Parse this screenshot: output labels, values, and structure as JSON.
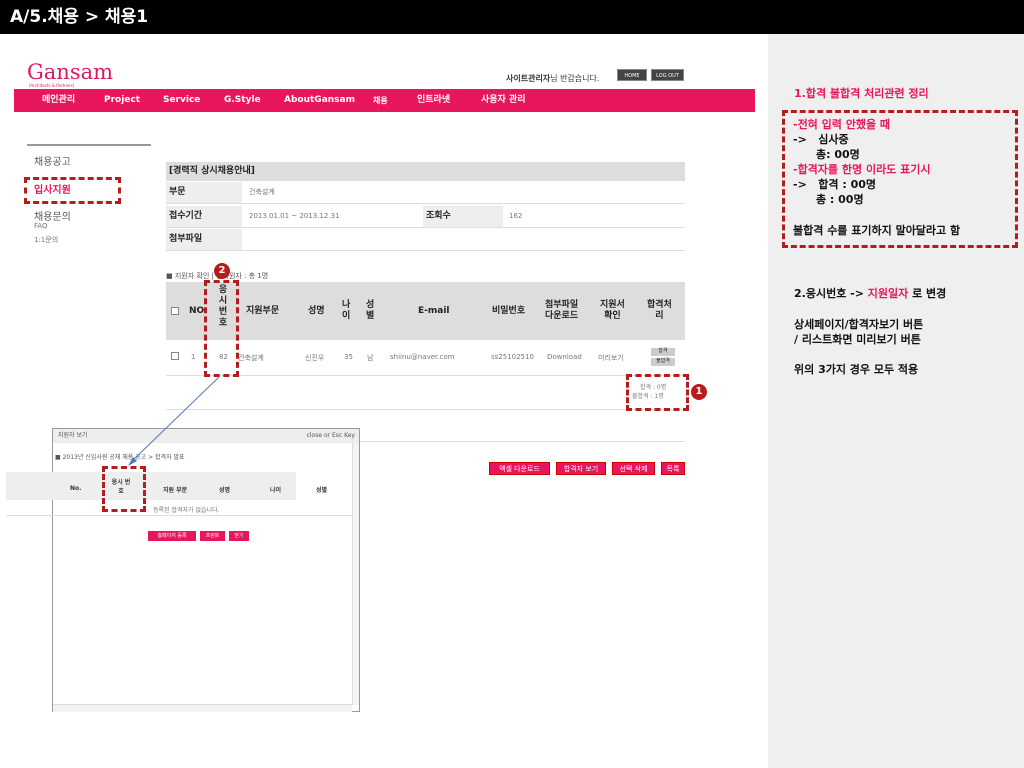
{
  "page": {
    "title": "A/5.채용 > 채용1"
  },
  "header": {
    "logo": "Gansam",
    "logo_sub": "(Architects & Partners)",
    "welcome_bold": "사이트관리자",
    "welcome_rest": "님 반갑습니다.",
    "home_label": "HOME",
    "logout_label": "LOG OUT"
  },
  "nav": {
    "items": [
      "메인관리",
      "Project",
      "Service",
      "G.Style",
      "AboutGansam",
      "채용",
      "인트라넷",
      "사용자 관리"
    ]
  },
  "sidebar": {
    "items": [
      "채용공고",
      "입사지원",
      "채용문의",
      "FAQ",
      "1:1문의"
    ]
  },
  "detail": {
    "section_title": "[경력직 상시채용안내]",
    "dept_label": "부문",
    "dept_value": "건축설계",
    "period_label": "접수기간",
    "period_value": "2013.01.01 ~ 2013.12.31",
    "views_label": "조회수",
    "views_value": "162",
    "attach_label": "첨부파일"
  },
  "applicants": {
    "count_text": "■ 지원자 확인 | 총지원자 : 총 1명",
    "headers": {
      "no": "NO",
      "exam_no": [
        "응",
        "시",
        "번",
        "호"
      ],
      "dept": "지원부문",
      "name": "성명",
      "age": [
        "나",
        "이"
      ],
      "gender": [
        "성",
        "별"
      ],
      "email": "E-mail",
      "password": "비밀번호",
      "file": [
        "첨부파일",
        "다운로드"
      ],
      "app": [
        "지원서",
        "확인"
      ],
      "pass": [
        "합격처",
        "리"
      ]
    },
    "row": {
      "no": "1",
      "exam_no": "82",
      "dept": "건축설계",
      "name": "신진우",
      "age": "35",
      "gender": "남",
      "email": "shiinu@naver.com",
      "password": "ss25102510",
      "file": "Download",
      "app": "미리보기",
      "pass_btn": "합격",
      "fail_btn": "불합격"
    },
    "summary_pass": "합격 : 0명",
    "summary_fail": "불합격 : 1명",
    "actions": [
      "엑셀 다운로드",
      "합격자 보기",
      "선택 삭제",
      "목록"
    ]
  },
  "popup": {
    "title": "지원자 보기",
    "close_hint": "close or Esc Key",
    "breadcrumb": "■ 2013년 신입사원 공채 채용 공고 > 합격자 발표",
    "headers": [
      "No.",
      "응시 번 호",
      "지원 부문",
      "성명",
      "나이",
      "성별"
    ],
    "empty_msg": "등록된 합격자가 없습니다.",
    "buttons": [
      "홈페이지 등록",
      "프린트",
      "닫기"
    ]
  },
  "annotations": {
    "marker1": "1",
    "marker2": "2",
    "note1_title": "1.합격 불합격 처리관련 정리",
    "note1_lines": [
      "-전혀 입력 안했을 때",
      "->   심사중",
      "      총: 00명",
      "-합격자를 한명 이라도 표기시",
      "->   합격 : 00명",
      "      총 : 00명"
    ],
    "note1_footer": "불합격 수를 표기하지 말아달라고 함",
    "note2_prefix": "2.응시번호 -> ",
    "note2_highlight": "지원일자",
    "note2_suffix": " 로 변경",
    "note3_line1": "상세페이지/합격자보기 버튼",
    "note3_line2": "/ 리스트화면 미리보기 버튼",
    "note4": "위의 3가지 경우 모두 적용"
  },
  "colors": {
    "accent": "#e8175d",
    "annotation_red": "#b71c1c"
  }
}
